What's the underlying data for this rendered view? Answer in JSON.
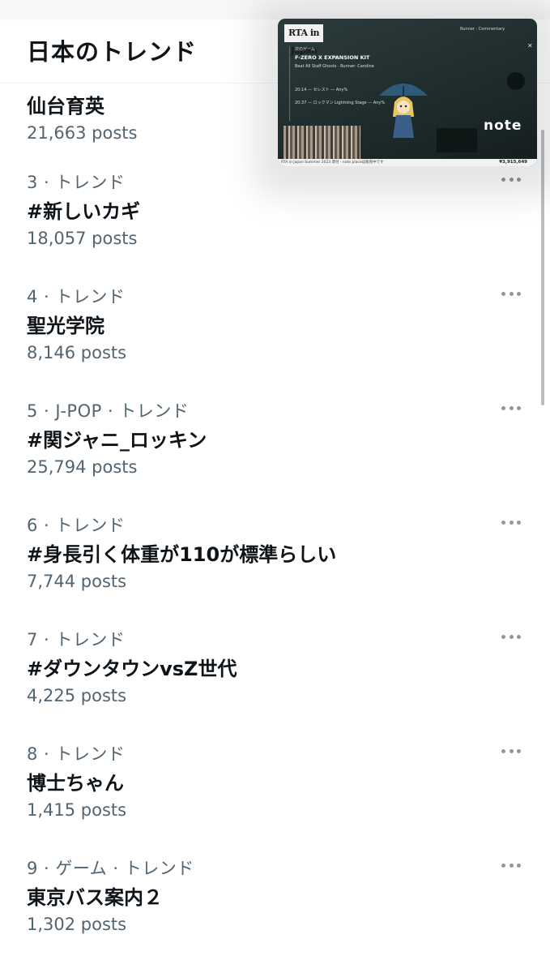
{
  "header": {
    "title": "日本のトレンド"
  },
  "trends": [
    {
      "meta": "",
      "name": "仙台育英",
      "count": "21,663 posts"
    },
    {
      "meta": "3 · トレンド",
      "name": "#新しいカギ",
      "count": "18,057 posts"
    },
    {
      "meta": "4 · トレンド",
      "name": "聖光学院",
      "count": "8,146 posts"
    },
    {
      "meta": "5 · J-POP · トレンド",
      "name": "#関ジャニ_ロッキン",
      "count": "25,794 posts"
    },
    {
      "meta": "6 · トレンド",
      "name": "#身長引く体重が110が標準らしい",
      "count": "7,744 posts"
    },
    {
      "meta": "7 · トレンド",
      "name": "#ダウンタウンvsZ世代",
      "count": "4,225 posts"
    },
    {
      "meta": "8 · トレンド",
      "name": "博士ちゃん",
      "count": "1,415 posts"
    },
    {
      "meta": "9 · ゲーム · トレンド",
      "name": "東京バス案内２",
      "count": "1,302 posts"
    }
  ],
  "video_overlay": {
    "logo": "RTA in Japan",
    "runner": "Runner · Commentary",
    "current_game": "F-ZERO X EXPANSION KIT",
    "current_detail": "Beat All Staff Ghosts · Runner: Caroline",
    "rows": [
      "次のゲーム",
      "20:14 — セレスト — Any%",
      "20:37 — ロックマン Lightning Stage — Any%"
    ],
    "brand": "note",
    "ticker": "RTA in Japan Summer 2023 寄付 · note placeは販売中です",
    "amount": "¥3,915,649"
  },
  "colors": {
    "text_primary": "#0f1419",
    "text_secondary": "#536471",
    "more_dots": "#8b98a5"
  }
}
